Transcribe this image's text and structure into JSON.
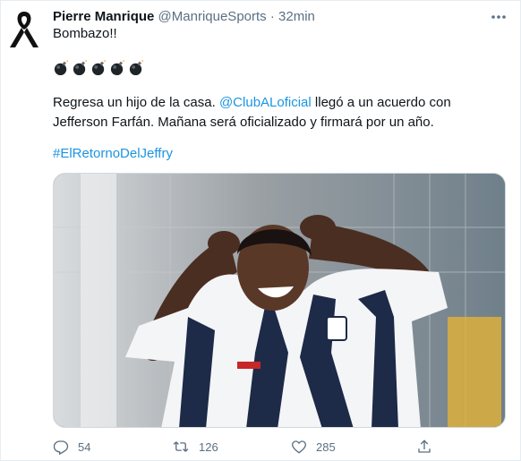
{
  "tweet": {
    "author_name": "Pierre Manrique",
    "handle": "@ManriqueSports",
    "separator": "·",
    "time": "32min",
    "line1": "Bombazo!!",
    "body_part1": "Regresa un hijo de la casa. ",
    "mention": "@ClubALoficial",
    "body_part2": " llegó a un acuerdo con Jefferson Farfán. Mañana será oficializado y firmará por un año.",
    "hashtag": "#ElRetornoDelJeffry",
    "bomb_emoji_count": 5,
    "bomb_icon": "bomb-emoji"
  },
  "actions": {
    "reply_count": "54",
    "retweet_count": "126",
    "like_count": "285"
  },
  "colors": {
    "link": "#1b95e0",
    "secondary": "#5b7083"
  }
}
